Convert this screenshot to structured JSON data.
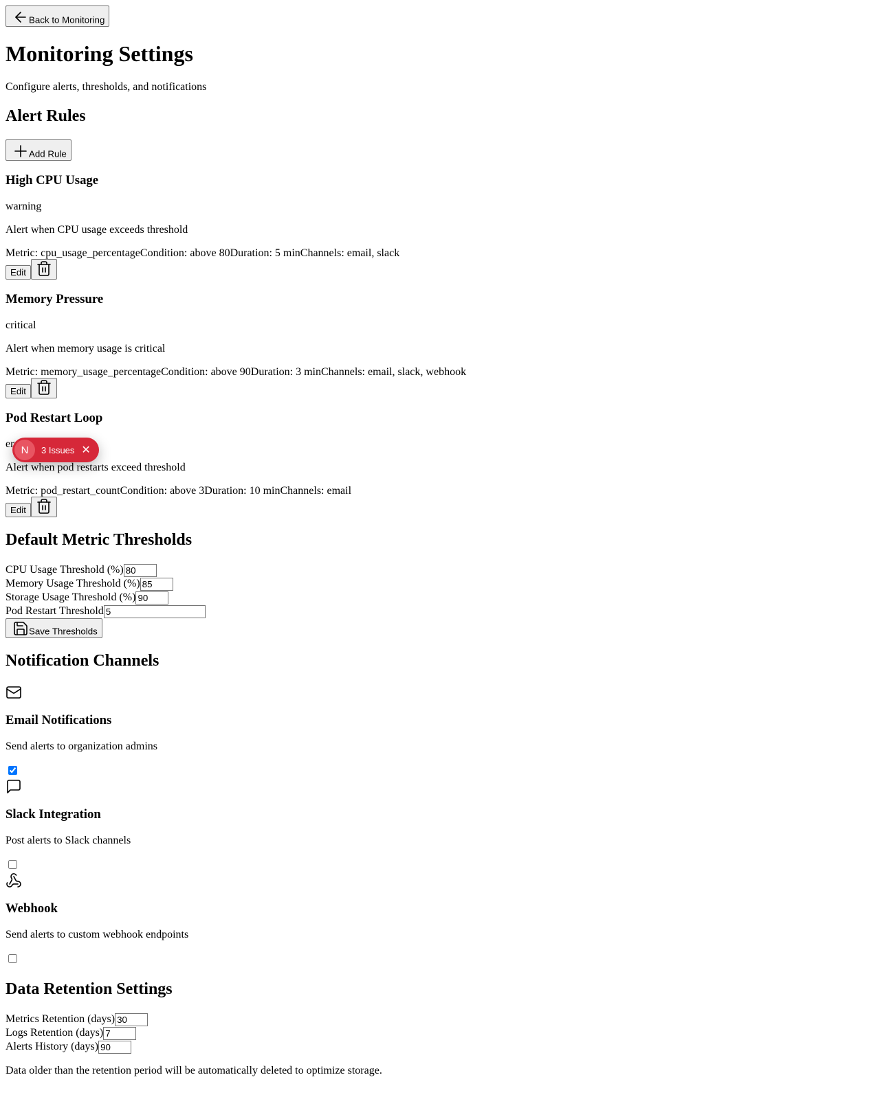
{
  "nav": {
    "back_label": "Back to Monitoring"
  },
  "header": {
    "title": "Monitoring Settings",
    "subtitle": "Configure alerts, thresholds, and notifications"
  },
  "alert_rules": {
    "heading": "Alert Rules",
    "add_label": "Add Rule",
    "edit_label": "Edit",
    "rules": [
      {
        "name": "High CPU Usage",
        "severity": "warning",
        "description": "Alert when CPU usage exceeds threshold",
        "metric": "Metric: cpu_usage_percentage",
        "condition": "Condition: above 80",
        "duration": "Duration: 5 min",
        "channels": "Channels: email, slack"
      },
      {
        "name": "Memory Pressure",
        "severity": "critical",
        "description": "Alert when memory usage is critical",
        "metric": "Metric: memory_usage_percentage",
        "condition": "Condition: above 90",
        "duration": "Duration: 3 min",
        "channels": "Channels: email, slack, webhook"
      },
      {
        "name": "Pod Restart Loop",
        "severity": "error",
        "description": "Alert when pod restarts exceed threshold",
        "metric": "Metric: pod_restart_count",
        "condition": "Condition: above 3",
        "duration": "Duration: 10 min",
        "channels": "Channels: email"
      }
    ]
  },
  "thresholds": {
    "heading": "Default Metric Thresholds",
    "cpu_label": "CPU Usage Threshold (%)",
    "cpu_value": "80",
    "memory_label": "Memory Usage Threshold (%)",
    "memory_value": "85",
    "storage_label": "Storage Usage Threshold (%)",
    "storage_value": "90",
    "pod_label": "Pod Restart Threshold",
    "pod_value": "5",
    "save_label": "Save Thresholds"
  },
  "channels": {
    "heading": "Notification Channels",
    "items": [
      {
        "title": "Email Notifications",
        "description": "Send alerts to organization admins",
        "enabled": true,
        "icon": "mail-icon"
      },
      {
        "title": "Slack Integration",
        "description": "Post alerts to Slack channels",
        "enabled": false,
        "icon": "message-square-icon"
      },
      {
        "title": "Webhook",
        "description": "Send alerts to custom webhook endpoints",
        "enabled": false,
        "icon": "webhook-icon"
      }
    ]
  },
  "retention": {
    "heading": "Data Retention Settings",
    "metrics_label": "Metrics Retention (days)",
    "metrics_value": "30",
    "logs_label": "Logs Retention (days)",
    "logs_value": "7",
    "alerts_label": "Alerts History (days)",
    "alerts_value": "90",
    "note": "Data older than the retention period will be automatically deleted to optimize storage."
  },
  "issues_badge": {
    "avatar_letter": "N",
    "count_label": "3 Issues",
    "close_glyph": "✕",
    "color": "#d62839"
  }
}
